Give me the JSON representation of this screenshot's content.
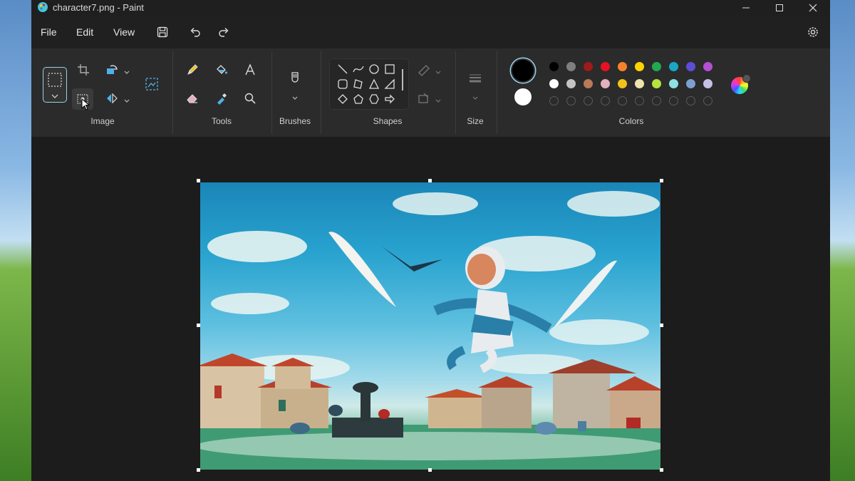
{
  "window": {
    "title": "character7.png - Paint"
  },
  "menu": {
    "file": "File",
    "edit": "Edit",
    "view": "View"
  },
  "ribbon": {
    "groups": {
      "image": "Image",
      "tools": "Tools",
      "brushes": "Brushes",
      "shapes": "Shapes",
      "size": "Size",
      "colors": "Colors"
    }
  },
  "colors": {
    "primary": "#000000",
    "secondary": "#ffffff",
    "palette_row1": [
      "#000000",
      "#7f7f7f",
      "#9e1b1b",
      "#e81123",
      "#f7822b",
      "#ffd400",
      "#22a94f",
      "#1aa7c5",
      "#5b4fd6",
      "#b54fd6"
    ],
    "palette_row2": [
      "#ffffff",
      "#c3c3c3",
      "#b97a57",
      "#e3b0c0",
      "#f2c21a",
      "#efe3b0",
      "#b7e23f",
      "#8ee0e4",
      "#7f9fcf",
      "#c8bfe7"
    ],
    "accent": "#9ad0e8"
  },
  "icons": {
    "app": "paint-icon",
    "minimize": "minimize-icon",
    "maximize": "maximize-icon",
    "close": "close-icon",
    "save": "save-icon",
    "undo": "undo-icon",
    "redo": "redo-icon",
    "settings": "gear-icon"
  }
}
